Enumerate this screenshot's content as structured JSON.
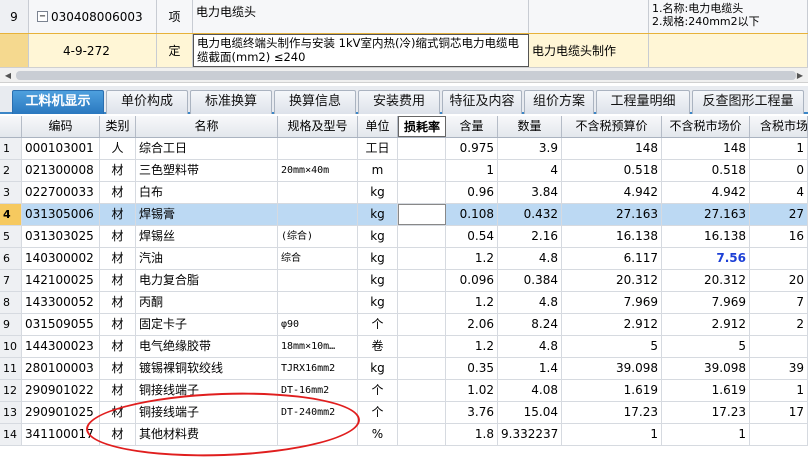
{
  "top_rows": [
    {
      "idx": "9",
      "code": "030408006003",
      "type": "项",
      "name": "电力电缆头",
      "feature_lines": [
        "1.名称:电力电缆头",
        "2.规格:240mm2以下"
      ]
    },
    {
      "idx": "",
      "code": "4-9-272",
      "type": "定",
      "name": "电力电缆终端头制作与安装 1kV室内热(冷)缩式铜芯电力电缆电缆截面(mm2) ≤240",
      "content": "电力电缆头制作"
    }
  ],
  "tabs": [
    "工料机显示",
    "单价构成",
    "标准换算",
    "换算信息",
    "安装费用",
    "特征及内容",
    "组价方案",
    "工程量明细",
    "反查图形工程量"
  ],
  "active_tab": 0,
  "columns": [
    "",
    "编码",
    "类别",
    "名称",
    "规格及型号",
    "单位",
    "损耗率",
    "含量",
    "数量",
    "不含税预算价",
    "不含税市场价",
    "含税市场价"
  ],
  "rows": [
    {
      "idx": "1",
      "code": "000103001",
      "cat": "人",
      "name": "综合工日",
      "spec": "",
      "unit": "工日",
      "loss": "",
      "qty": "0.975",
      "amount": "3.9",
      "budget": "148",
      "market": "148",
      "tax": "1"
    },
    {
      "idx": "2",
      "code": "021300008",
      "cat": "材",
      "name": "三色塑料带",
      "spec": "20mm×40m",
      "unit": "m",
      "loss": "",
      "qty": "1",
      "amount": "4",
      "budget": "0.518",
      "market": "0.518",
      "tax": "0"
    },
    {
      "idx": "3",
      "code": "022700033",
      "cat": "材",
      "name": "白布",
      "spec": "",
      "unit": "kg",
      "loss": "",
      "qty": "0.96",
      "amount": "3.84",
      "budget": "4.942",
      "market": "4.942",
      "tax": "4"
    },
    {
      "idx": "4",
      "code": "031305006",
      "cat": "材",
      "name": "焊锡膏",
      "spec": "",
      "unit": "kg",
      "loss": "",
      "qty": "0.108",
      "amount": "0.432",
      "budget": "27.163",
      "market": "27.163",
      "tax": "27"
    },
    {
      "idx": "5",
      "code": "031303025",
      "cat": "材",
      "name": "焊锡丝",
      "spec": "(综合)",
      "unit": "kg",
      "loss": "",
      "qty": "0.54",
      "amount": "2.16",
      "budget": "16.138",
      "market": "16.138",
      "tax": "16"
    },
    {
      "idx": "6",
      "code": "140300002",
      "cat": "材",
      "name": "汽油",
      "spec": "综合",
      "unit": "kg",
      "loss": "",
      "qty": "1.2",
      "amount": "4.8",
      "budget": "6.117",
      "market": "7.56",
      "tax": ""
    },
    {
      "idx": "7",
      "code": "142100025",
      "cat": "材",
      "name": "电力复合脂",
      "spec": "",
      "unit": "kg",
      "loss": "",
      "qty": "0.096",
      "amount": "0.384",
      "budget": "20.312",
      "market": "20.312",
      "tax": "20"
    },
    {
      "idx": "8",
      "code": "143300052",
      "cat": "材",
      "name": "丙酮",
      "spec": "",
      "unit": "kg",
      "loss": "",
      "qty": "1.2",
      "amount": "4.8",
      "budget": "7.969",
      "market": "7.969",
      "tax": "7"
    },
    {
      "idx": "9",
      "code": "031509055",
      "cat": "材",
      "name": "固定卡子",
      "spec": "φ90",
      "unit": "个",
      "loss": "",
      "qty": "2.06",
      "amount": "8.24",
      "budget": "2.912",
      "market": "2.912",
      "tax": "2"
    },
    {
      "idx": "10",
      "code": "144300023",
      "cat": "材",
      "name": "电气绝缘胶带",
      "spec": "18mm×10m…",
      "unit": "卷",
      "loss": "",
      "qty": "1.2",
      "amount": "4.8",
      "budget": "5",
      "market": "5",
      "tax": ""
    },
    {
      "idx": "11",
      "code": "280100003",
      "cat": "材",
      "name": "镀锡裸铜软绞线",
      "spec": "TJRX16mm2",
      "unit": "kg",
      "loss": "",
      "qty": "0.35",
      "amount": "1.4",
      "budget": "39.098",
      "market": "39.098",
      "tax": "39"
    },
    {
      "idx": "12",
      "code": "290901022",
      "cat": "材",
      "name": "铜接线端子",
      "spec": "DT-16mm2",
      "unit": "个",
      "loss": "",
      "qty": "1.02",
      "amount": "4.08",
      "budget": "1.619",
      "market": "1.619",
      "tax": "1"
    },
    {
      "idx": "13",
      "code": "290901025",
      "cat": "材",
      "name": "铜接线端子",
      "spec": "DT-240mm2",
      "unit": "个",
      "loss": "",
      "qty": "3.76",
      "amount": "15.04",
      "budget": "17.23",
      "market": "17.23",
      "tax": "17"
    },
    {
      "idx": "14",
      "code": "341100017",
      "cat": "材",
      "name": "其他材料费",
      "spec": "",
      "unit": "%",
      "loss": "",
      "qty": "1.8",
      "amount": "9.332237",
      "budget": "1",
      "market": "1",
      "tax": ""
    }
  ],
  "highlight_row": 3,
  "colors": {
    "tab_active": "#2a78bf",
    "row_highlight": "#bcd9f3",
    "annotation": "#e01e1e",
    "market_price_changed": "#1c3fd6"
  }
}
